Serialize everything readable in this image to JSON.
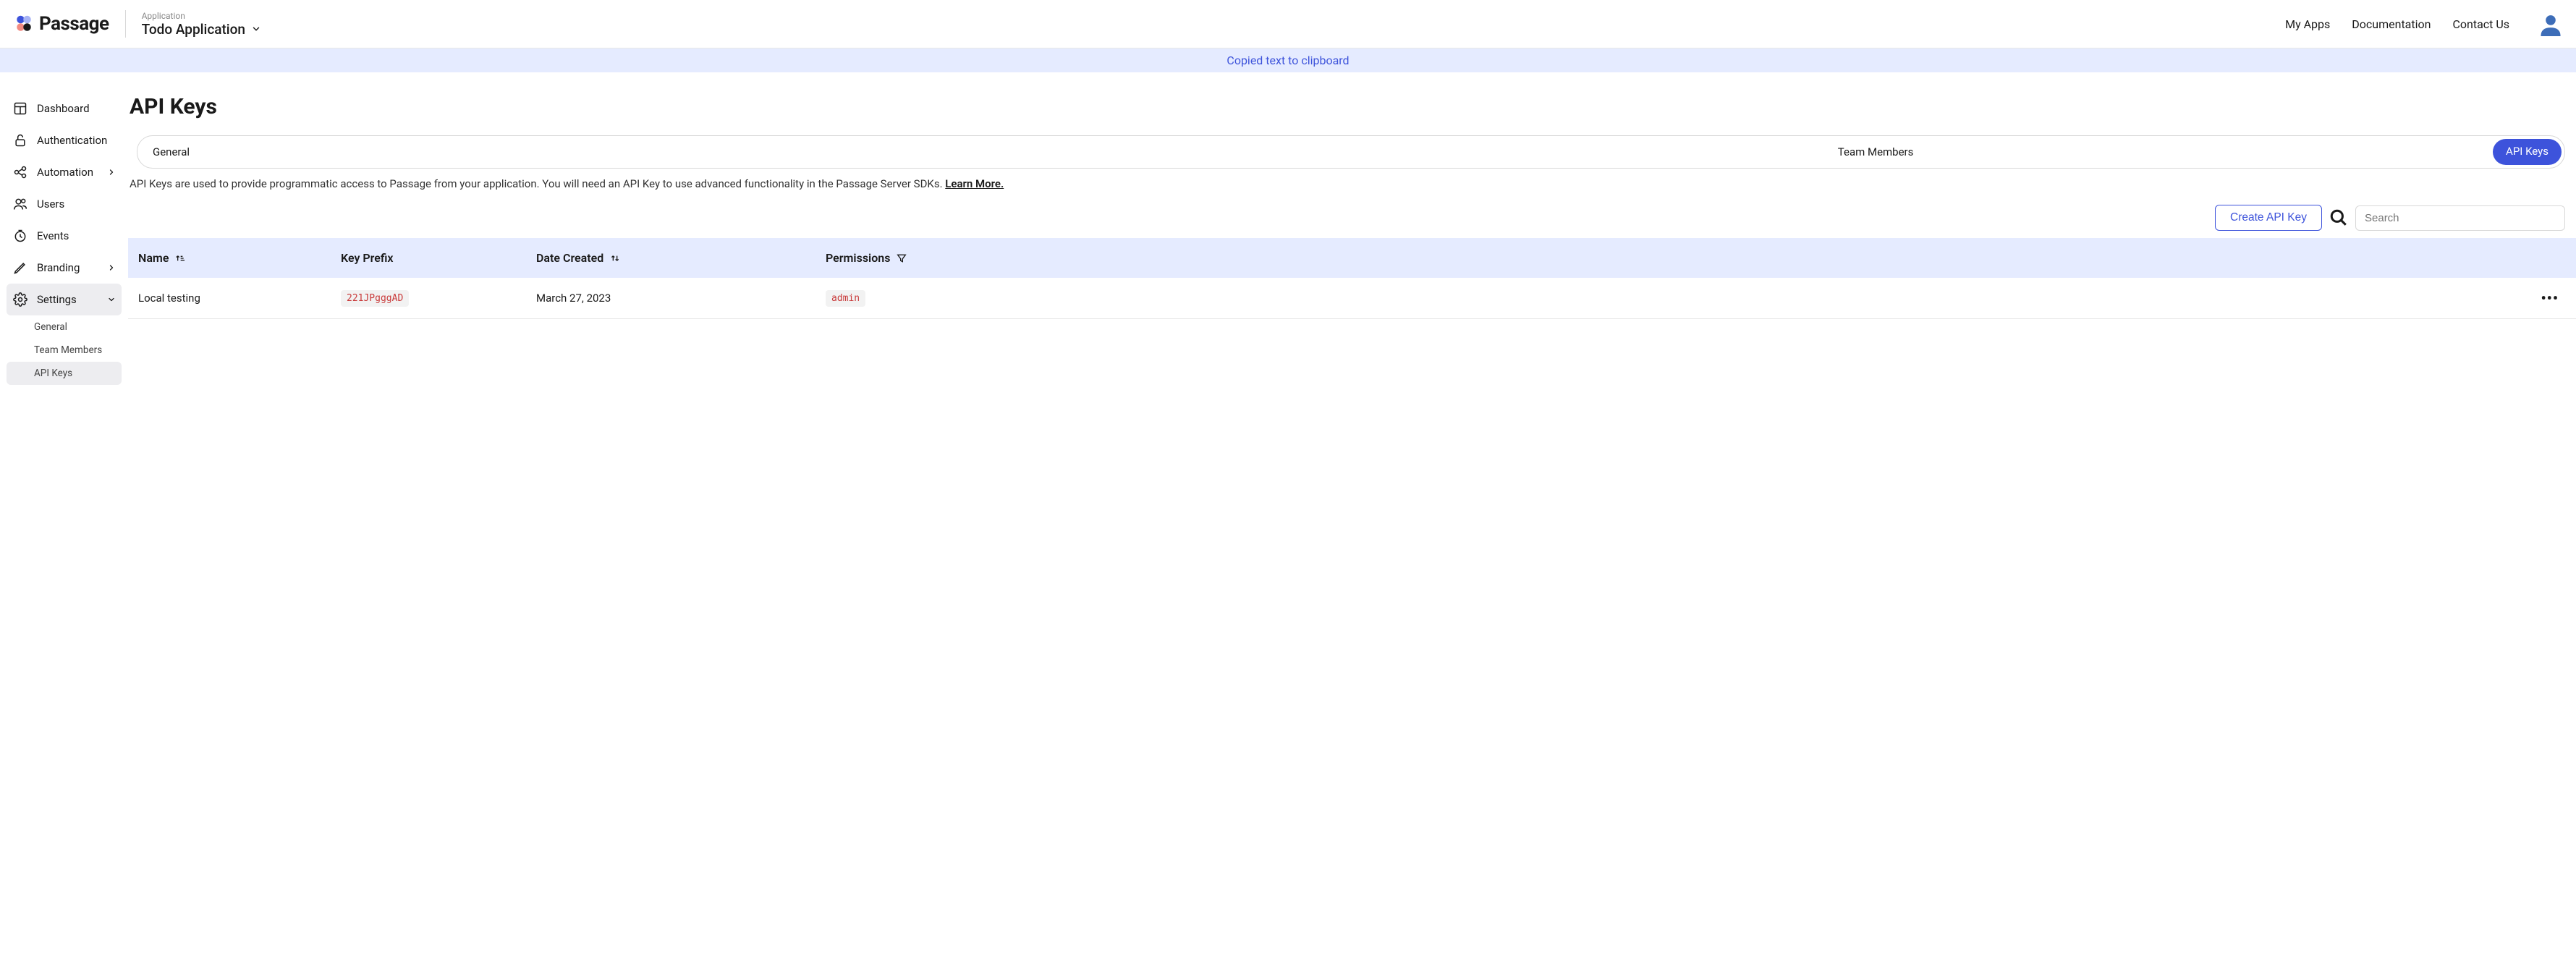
{
  "header": {
    "brand": "Passage",
    "app_label": "Application",
    "app_name": "Todo Application",
    "nav": {
      "my_apps": "My Apps",
      "documentation": "Documentation",
      "contact_us": "Contact Us"
    }
  },
  "toast": {
    "message": "Copied text to clipboard"
  },
  "sidebar": {
    "items": [
      {
        "label": "Dashboard"
      },
      {
        "label": "Authentication"
      },
      {
        "label": "Automation"
      },
      {
        "label": "Users"
      },
      {
        "label": "Events"
      },
      {
        "label": "Branding"
      },
      {
        "label": "Settings"
      }
    ],
    "settings_subitems": [
      {
        "label": "General"
      },
      {
        "label": "Team Members"
      },
      {
        "label": "API Keys"
      }
    ]
  },
  "page": {
    "title": "API Keys",
    "tabs": {
      "general": "General",
      "team_members": "Team Members",
      "api_keys": "API Keys"
    },
    "description_text": "API Keys are used to provide programmatic access to Passage from your application. You will need an API Key to use advanced functionality in the Passage Server SDKs. ",
    "learn_more": "Learn More.",
    "create_button": "Create API Key",
    "search_placeholder": "Search"
  },
  "table": {
    "headers": {
      "name": "Name",
      "key_prefix": "Key Prefix",
      "date_created": "Date Created",
      "permissions": "Permissions"
    },
    "rows": [
      {
        "name": "Local testing",
        "prefix": "221JPgggAD",
        "date": "March 27, 2023",
        "permission": "admin"
      }
    ]
  }
}
